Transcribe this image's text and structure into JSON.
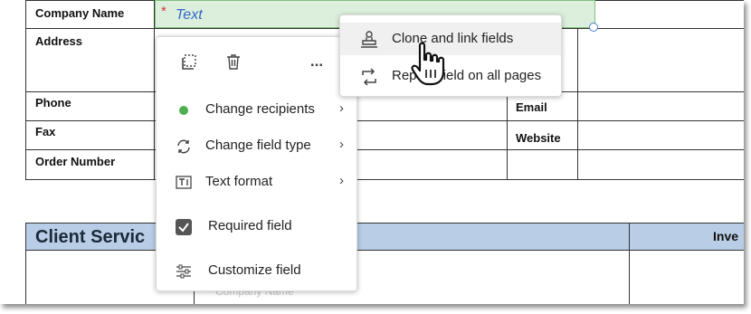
{
  "form": {
    "labels": {
      "company_name": "Company Name",
      "address": "Address",
      "phone": "Phone",
      "fax": "Fax",
      "order_number": "Order Number",
      "email": "Email",
      "website": "Website"
    },
    "company_field": {
      "required_marker": "*",
      "placeholder": "Text",
      "fill_color": "#dcefdc",
      "border_color": "#7fbf7f"
    },
    "sections": {
      "client_services": "Client Servic",
      "right_section": "Inve"
    },
    "band_color": "#b9cde6"
  },
  "field_menu": {
    "toolbar": {
      "icons": [
        "select-icon",
        "trash-icon",
        "more-options-icon"
      ],
      "more_label": "..."
    },
    "items": [
      {
        "label": "Change recipients",
        "icon": "green-dot-icon",
        "has_submenu": true,
        "icon_color": "#4caf50"
      },
      {
        "label": "Change field type",
        "icon": "convert-icon",
        "has_submenu": true
      },
      {
        "label": "Text format",
        "icon": "text-format-icon",
        "has_submenu": true
      },
      {
        "label": "Required field",
        "icon": "checkbox-checked-icon",
        "has_submenu": false,
        "checked": true
      },
      {
        "label": "Customize field",
        "icon": "sliders-icon",
        "has_submenu": false
      }
    ],
    "chevron": "›"
  },
  "submenu": {
    "items": [
      {
        "label": "Clone and link fields",
        "icon": "clone-link-icon",
        "hovered": true
      },
      {
        "label": "Repeat field on all pages",
        "icon": "repeat-icon",
        "hovered": false
      }
    ]
  }
}
